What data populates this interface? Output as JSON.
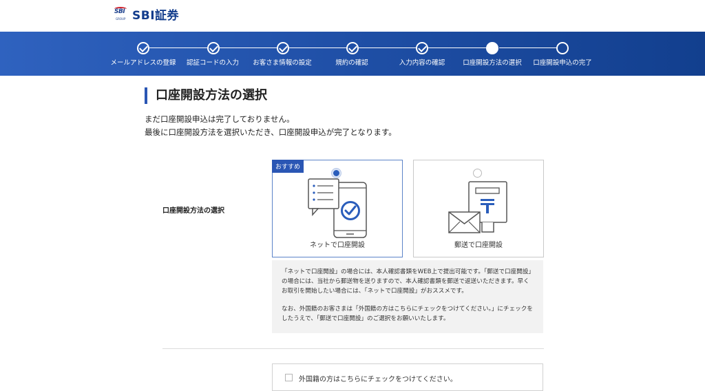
{
  "brand": {
    "logo_mark": "SBI",
    "logo_group": "GROUP",
    "name": "SBI証券"
  },
  "steps": [
    {
      "label": "メールアドレスの登録",
      "state": "done"
    },
    {
      "label": "認証コードの入力",
      "state": "done"
    },
    {
      "label": "お客さま情報の設定",
      "state": "done"
    },
    {
      "label": "規約の確認",
      "state": "done"
    },
    {
      "label": "入力内容の確認",
      "state": "done"
    },
    {
      "label": "口座開設方法の選択",
      "state": "current"
    },
    {
      "label": "口座開設申込の完了",
      "state": "todo"
    }
  ],
  "page": {
    "title": "口座開設方法の選択",
    "lead_1": "まだ口座開設申込は完了しておりません。",
    "lead_2": "最後に口座開設方法を選択いただき、口座開設申込が完了となります。"
  },
  "form": {
    "row_label": "口座開設方法の選択",
    "options": [
      {
        "label": "ネットで口座開設",
        "badge": "おすすめ",
        "selected": true,
        "icon": "smartphone-check-icon"
      },
      {
        "label": "郵送で口座開設",
        "selected": false,
        "icon": "mail-post-icon"
      }
    ],
    "note_1": "「ネットで口座開設」の場合には、本人確認書類をWEB上で提出可能です。「郵送で口座開設」の場合には、当社から郵送物を送りますので、本人確認書類を郵送で返送いただきます。早くお取引を開始したい場合には、「ネットで口座開設」がおススメです。",
    "note_2": "なお、外国籍のお客さまは「外国籍の方はこちらにチェックをつけてください。」にチェックをしたうえで、「郵送で口座開設」のご選択をお願いいたします。",
    "foreign_checkbox_label": "外国籍の方はこちらにチェックをつけてください。"
  },
  "colors": {
    "accent": "#2a56b4",
    "stepbar_start": "#2f62bf",
    "stepbar_end": "#123f8e"
  }
}
